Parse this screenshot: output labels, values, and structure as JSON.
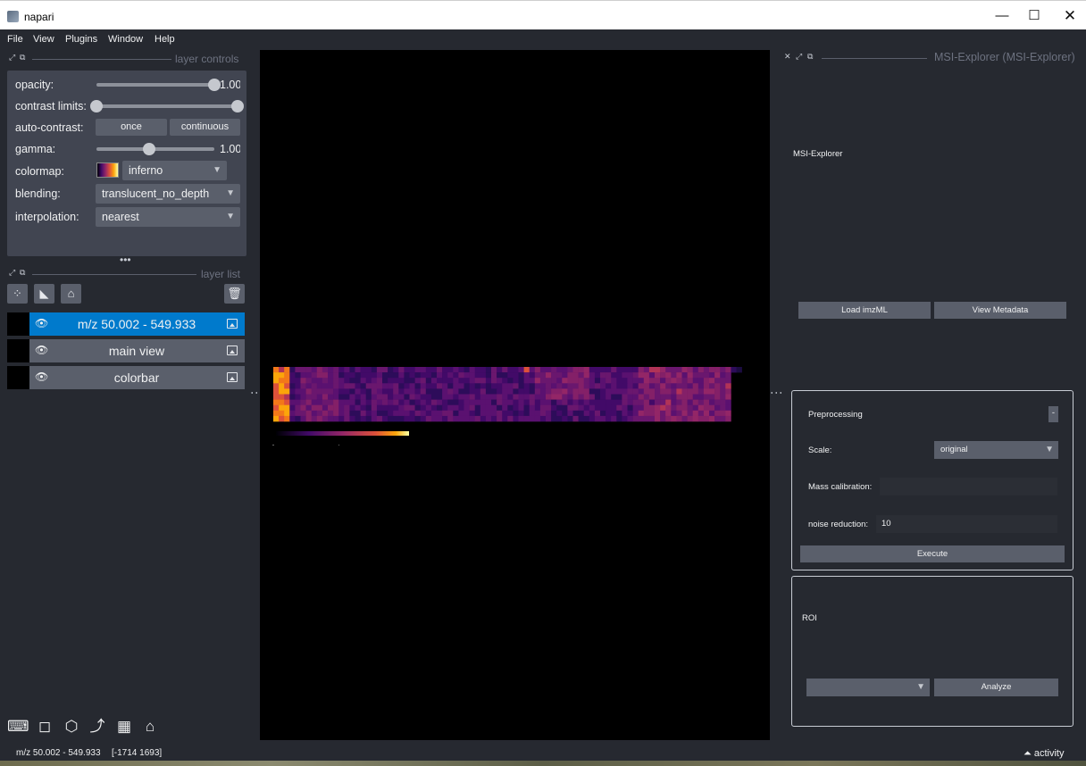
{
  "window": {
    "title": "napari",
    "minimize": "—",
    "maximize": "☐",
    "close": "✕"
  },
  "menu": [
    "File",
    "View",
    "Plugins",
    "Window",
    "Help"
  ],
  "layer_controls": {
    "header": "layer controls",
    "opacity_label": "opacity:",
    "opacity_value": "1.00",
    "opacity_level": 1.0,
    "contrast_label": "contrast limits:",
    "contrast_range": [
      0.0,
      1.0
    ],
    "autocontrast_label": "auto-contrast:",
    "once_label": "once",
    "continuous_label": "continuous",
    "gamma_label": "gamma:",
    "gamma_value": "1.00",
    "gamma_level": 0.45,
    "colormap_label": "colormap:",
    "colormap_value": "inferno",
    "blending_label": "blending:",
    "blending_value": "translucent_no_depth",
    "interpolation_label": "interpolation:",
    "interpolation_value": "nearest"
  },
  "layer_list": {
    "header": "layer list",
    "layers": [
      {
        "name": "m/z 50.002 - 549.933",
        "selected": true
      },
      {
        "name": "main view",
        "selected": false
      },
      {
        "name": "colorbar",
        "selected": false
      }
    ]
  },
  "msi": {
    "dock_title": "MSI-Explorer (MSI-Explorer)",
    "heading": "MSI-Explorer",
    "load_button": "Load imzML",
    "metadata_button": "View Metadata",
    "preprocessing": {
      "title": "Preprocessing",
      "collapse": "-",
      "scale_label": "Scale:",
      "scale_value": "original",
      "mass_calibration_label": "Mass calibration:",
      "mass_calibration_value": "",
      "noise_label": "noise reduction:",
      "noise_value": "10",
      "execute_button": "Execute"
    },
    "roi": {
      "title": "ROI",
      "select_value": "",
      "analyze_button": "Analyze"
    }
  },
  "status": {
    "layer_info": "m/z 50.002 - 549.933",
    "coords": "[-1714 1693]",
    "activity": "activity"
  }
}
